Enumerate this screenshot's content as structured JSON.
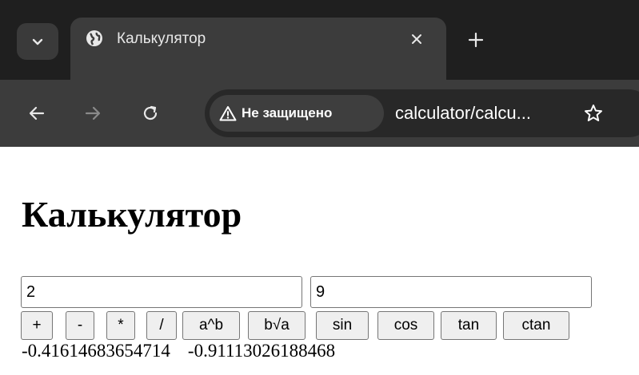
{
  "browser": {
    "tab": {
      "title": "Калькулятор"
    },
    "address_bar": {
      "security_label": "Не защищено",
      "url": "calculator/calcu..."
    },
    "colors": {
      "tabbar_bg": "#1f1f1f",
      "toolbar_bg": "#3c3c3c",
      "omnibox_bg": "#282828",
      "text": "#ffffff"
    },
    "icons": [
      "chevron-down-icon",
      "globe-icon",
      "close-icon",
      "plus-icon",
      "back-arrow-icon",
      "forward-arrow-icon",
      "reload-icon",
      "warning-triangle-icon",
      "star-icon"
    ]
  },
  "page": {
    "heading": "Калькулятор",
    "inputs": {
      "a": "2",
      "b": "9"
    },
    "buttons": [
      "+",
      "-",
      "*",
      "/",
      "a^b",
      "b√a",
      "sin",
      "cos",
      "tan",
      "ctan"
    ],
    "results": [
      "-0.41614683654714",
      "-0.91113026188468"
    ]
  }
}
